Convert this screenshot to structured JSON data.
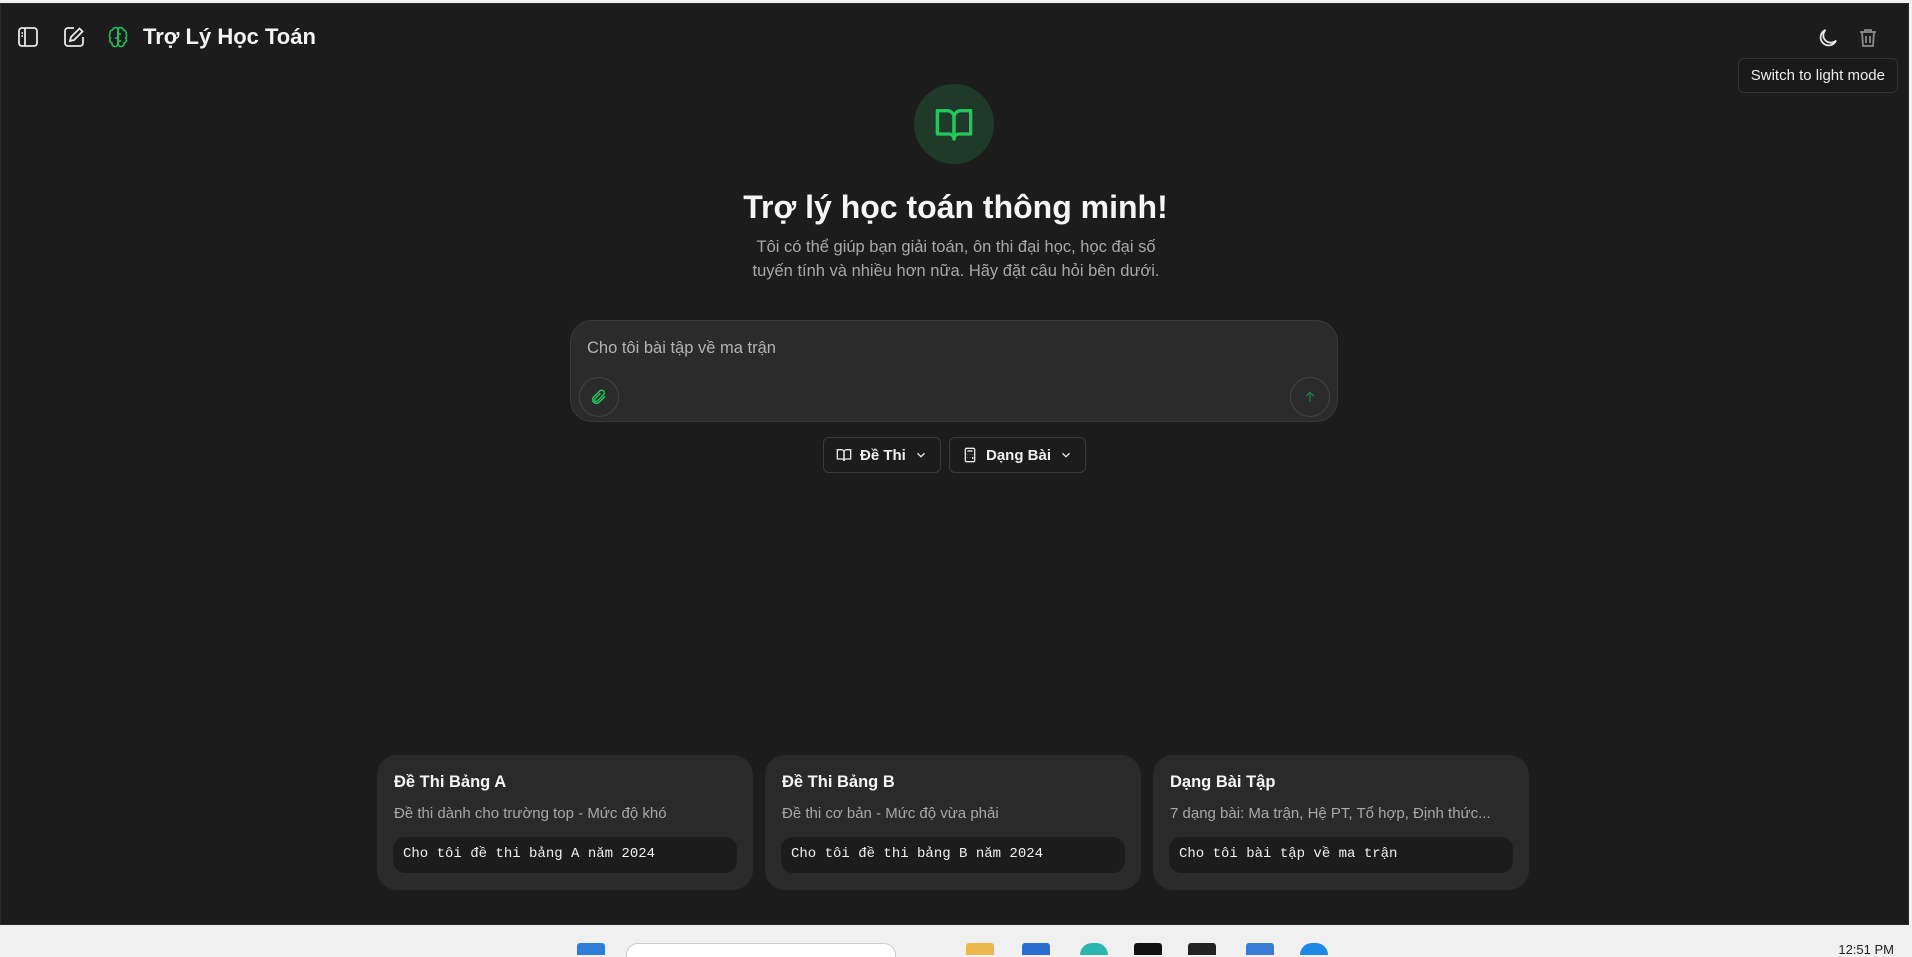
{
  "header": {
    "title": "Trợ Lý Học Toán",
    "tooltip": "Switch to light mode"
  },
  "hero": {
    "title": "Trợ lý học toán thông minh!",
    "subtitle": "Tôi có thể giúp bạn giải toán, ôn thi đại học, học đại số tuyến tính và nhiều hơn nữa. Hãy đặt câu hỏi bên dưới."
  },
  "composer": {
    "placeholder": "Cho tôi bài tập về ma trận"
  },
  "filters": {
    "exam_label": "Đề Thi",
    "type_label": "Dạng Bài"
  },
  "cards": [
    {
      "title": "Đề Thi Bảng A",
      "desc": "Đề thi dành cho trường top - Mức độ khó",
      "prompt": "Cho tôi đề thi bảng A năm 2024"
    },
    {
      "title": "Đề Thi Bảng B",
      "desc": "Đề thi cơ bản - Mức độ vừa phải",
      "prompt": "Cho tôi đề thi bảng B năm 2024"
    },
    {
      "title": "Dạng Bài Tập",
      "desc": "7 dạng bài: Ma trận, Hệ PT, Tổ hợp, Định thức...",
      "prompt": "Cho tôi bài tập về ma trận"
    }
  ],
  "taskbar": {
    "time": "12:51 PM"
  },
  "colors": {
    "accent": "#22c55e",
    "background": "#1c1c1c",
    "card": "#2a2a2a"
  }
}
